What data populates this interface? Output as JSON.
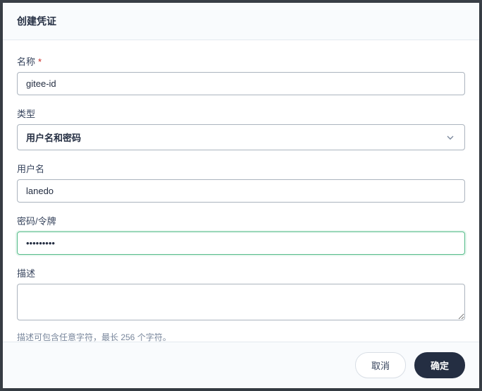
{
  "modal": {
    "title": "创建凭证",
    "footer": {
      "cancel": "取消",
      "confirm": "确定"
    }
  },
  "form": {
    "name": {
      "label": "名称",
      "value": "gitee-id"
    },
    "type": {
      "label": "类型",
      "value": "用户名和密码"
    },
    "username": {
      "label": "用户名",
      "value": "lanedo"
    },
    "password": {
      "label": "密码/令牌",
      "value": "•••••••••"
    },
    "description": {
      "label": "描述",
      "value": "",
      "help": "描述可包含任意字符，最长 256 个字符。"
    }
  }
}
